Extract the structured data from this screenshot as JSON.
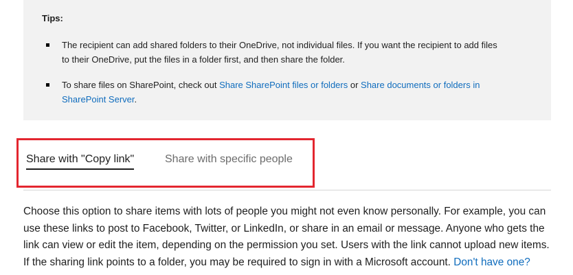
{
  "tips": {
    "title": "Tips:",
    "tip1": "The recipient can add shared folders to their OneDrive, not individual files. If you want the recipient to add files to their OneDrive, put the files in a folder first, and then share the folder.",
    "tip2_prefix": "To share files on SharePoint, check out ",
    "tip2_link1": "Share SharePoint files or folders",
    "tip2_mid": " or ",
    "tip2_link2": "Share documents or folders in SharePoint Server",
    "tip2_suffix": "."
  },
  "tabs": {
    "active_label": "Share with \"Copy link\"",
    "inactive_label": "Share with specific people"
  },
  "content": {
    "paragraph": "Choose this option to share items with lots of people you might not even know personally. For example, you can use these links to post to Facebook, Twitter, or LinkedIn, or share in an email or message. Anyone who gets the link can view or edit the item, depending on the permission you set. Users with the link cannot upload new items. If the sharing link points to a folder, you may be required to sign in with a Microsoft account. ",
    "link": "Don't have one?"
  },
  "colors": {
    "link": "#0f6cbd",
    "highlight_box": "#e3262f",
    "tips_background": "#f2f2f2"
  }
}
